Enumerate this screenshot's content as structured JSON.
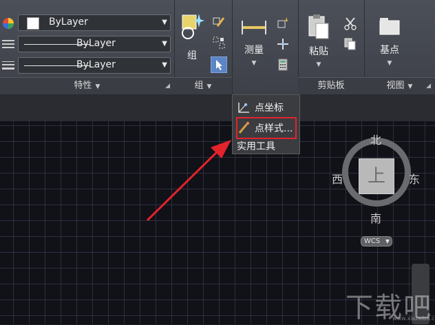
{
  "properties": {
    "color_value": "ByLayer",
    "linetype_value": "ByLayer",
    "lineweight_value": "ByLayer",
    "title": "特性"
  },
  "group_panel": {
    "group_button": "组",
    "title": "组"
  },
  "utilities": {
    "measure_button": "测量",
    "dropdown": {
      "items": [
        {
          "label": "点坐标",
          "icon": "point-coordinate-icon"
        },
        {
          "label": "点样式...",
          "icon": "point-style-icon"
        }
      ],
      "footer": "实用工具"
    }
  },
  "clipboard": {
    "paste_button": "粘贴",
    "title": "剪贴板"
  },
  "view": {
    "base_point_button": "基点",
    "title": "视图"
  },
  "viewcube": {
    "north": "北",
    "south": "南",
    "west": "西",
    "east": "东",
    "face": "上",
    "wcs": "WCS"
  },
  "watermark": {
    "text": "下载吧",
    "sub": "www.xiazaiba.com"
  },
  "colors": {
    "highlight": "#e3232b",
    "arrow": "#e3232b",
    "ribbon": "#454850",
    "canvas": "#111118"
  }
}
